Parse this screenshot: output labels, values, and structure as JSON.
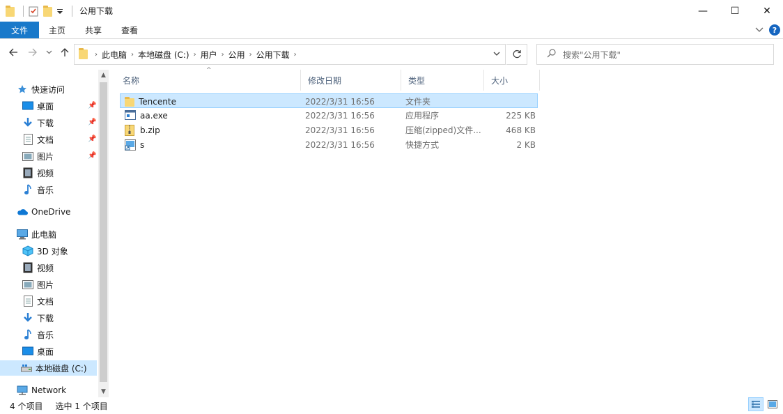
{
  "window": {
    "title": "公用下载",
    "controls": {
      "minimize": "—",
      "maximize": "☐",
      "close": "✕"
    }
  },
  "ribbon": {
    "tabs": [
      "文件",
      "主页",
      "共享",
      "查看"
    ],
    "expand_icon": "chevron-down-icon",
    "help_label": "?"
  },
  "address": {
    "breadcrumbs": [
      "此电脑",
      "本地磁盘 (C:)",
      "用户",
      "公用",
      "公用下载"
    ],
    "search_placeholder": "搜索\"公用下载\""
  },
  "nav_pane": {
    "quick_access": {
      "label": "快速访问",
      "items": [
        {
          "label": "桌面",
          "icon": "desktop-icon",
          "pinned": true
        },
        {
          "label": "下载",
          "icon": "download-icon",
          "pinned": true
        },
        {
          "label": "文档",
          "icon": "document-icon",
          "pinned": true
        },
        {
          "label": "图片",
          "icon": "picture-icon",
          "pinned": true
        },
        {
          "label": "视频",
          "icon": "video-icon",
          "pinned": false
        },
        {
          "label": "音乐",
          "icon": "music-icon",
          "pinned": false
        }
      ]
    },
    "onedrive": {
      "label": "OneDrive"
    },
    "this_pc": {
      "label": "此电脑",
      "items": [
        {
          "label": "3D 对象",
          "icon": "3d-objects-icon"
        },
        {
          "label": "视频",
          "icon": "video-icon"
        },
        {
          "label": "图片",
          "icon": "picture-icon"
        },
        {
          "label": "文档",
          "icon": "document-icon"
        },
        {
          "label": "下载",
          "icon": "download-icon"
        },
        {
          "label": "音乐",
          "icon": "music-icon"
        },
        {
          "label": "桌面",
          "icon": "desktop-icon"
        },
        {
          "label": "本地磁盘 (C:)",
          "icon": "drive-icon",
          "selected": true
        }
      ]
    },
    "network": {
      "label": "Network"
    }
  },
  "columns": {
    "name": "名称",
    "modified": "修改日期",
    "type": "类型",
    "size": "大小"
  },
  "files": [
    {
      "name": "Tencente",
      "modified": "2022/3/31 16:56",
      "type": "文件夹",
      "size": "",
      "icon": "folder-icon",
      "selected": true
    },
    {
      "name": "aa.exe",
      "modified": "2022/3/31 16:56",
      "type": "应用程序",
      "size": "225 KB",
      "icon": "exe-icon",
      "selected": false
    },
    {
      "name": "b.zip",
      "modified": "2022/3/31 16:56",
      "type": "压缩(zipped)文件...",
      "size": "468 KB",
      "icon": "zip-icon",
      "selected": false
    },
    {
      "name": "s",
      "modified": "2022/3/31 16:56",
      "type": "快捷方式",
      "size": "2 KB",
      "icon": "shortcut-icon",
      "selected": false
    }
  ],
  "status": {
    "count": "4 个项目",
    "selected": "选中 1 个项目"
  },
  "colors": {
    "accent": "#1979ca",
    "selection": "#cce8ff",
    "selection_border": "#99d1ff",
    "header_text": "#4c607a"
  }
}
